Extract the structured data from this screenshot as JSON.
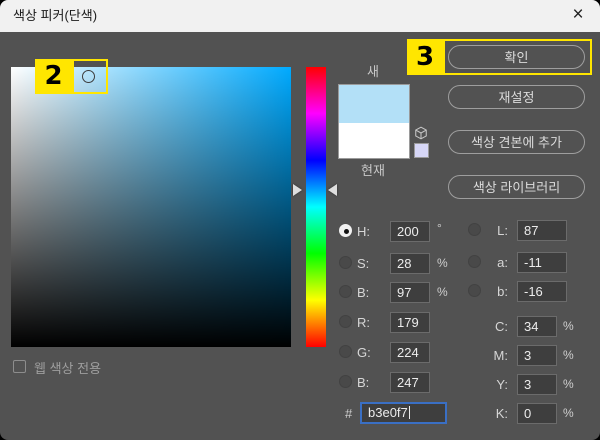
{
  "window": {
    "title": "색상 피커(단색)",
    "close_glyph": "×"
  },
  "buttons": {
    "ok": "확인",
    "reset": "재설정",
    "add_to_swatches": "색상 견본에 추가",
    "color_libraries": "색상 라이브러리"
  },
  "swatch": {
    "new_label": "새",
    "current_label": "현재",
    "new_color": "#b3e0f7",
    "current_color": "#ffffff",
    "web_warning_color": "#d7d7f7"
  },
  "fields": {
    "h": {
      "label": "H:",
      "value": "200",
      "unit": "°"
    },
    "s": {
      "label": "S:",
      "value": "28",
      "unit": "%"
    },
    "b": {
      "label": "B:",
      "value": "97",
      "unit": "%"
    },
    "r": {
      "label": "R:",
      "value": "179"
    },
    "g": {
      "label": "G:",
      "value": "224"
    },
    "b2": {
      "label": "B:",
      "value": "247"
    },
    "l": {
      "label": "L:",
      "value": "87"
    },
    "a": {
      "label": "a:",
      "value": "-11"
    },
    "lab_b": {
      "label": "b:",
      "value": "-16"
    },
    "c": {
      "label": "C:",
      "value": "34",
      "unit": "%"
    },
    "m": {
      "label": "M:",
      "value": "3",
      "unit": "%"
    },
    "y": {
      "label": "Y:",
      "value": "3",
      "unit": "%"
    },
    "k": {
      "label": "K:",
      "value": "0",
      "unit": "%"
    },
    "hex": {
      "label": "#",
      "value": "b3e0f7"
    }
  },
  "checkbox": {
    "label": "웹 색상 전용",
    "checked": false
  },
  "annotations": {
    "mark2": "2",
    "mark3": "3",
    "highlight_color": "#ffe600"
  },
  "picker_state": {
    "hue_degrees": "200",
    "picked_hex": "b3e0f7"
  }
}
